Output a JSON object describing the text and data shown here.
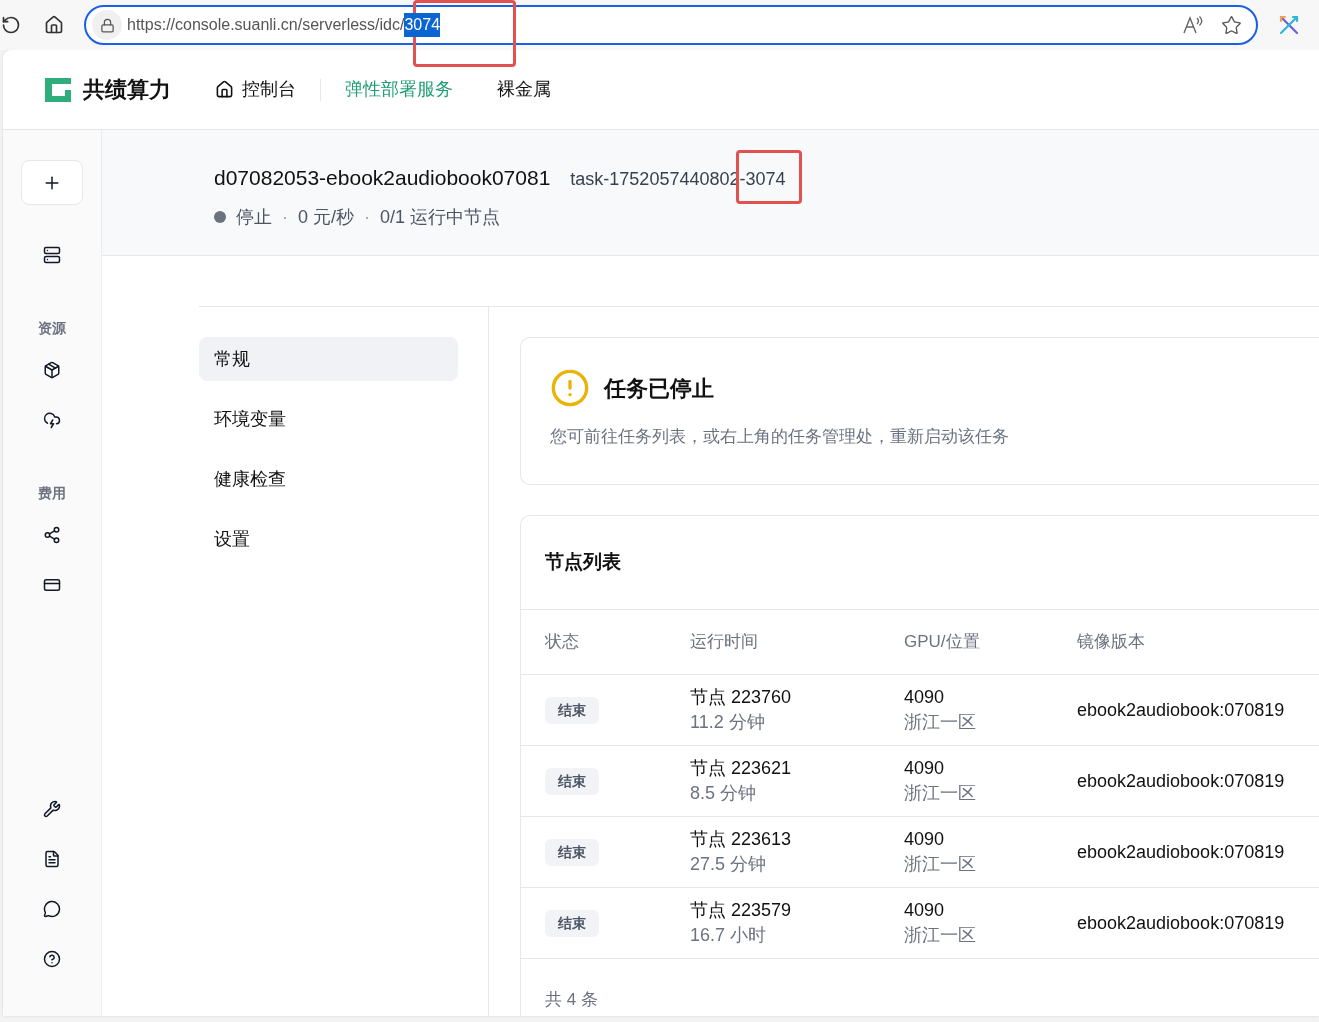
{
  "browser": {
    "url": "https://console.suanli.cn/serverless/idc/",
    "url_selected": "3074"
  },
  "header": {
    "brand": "共绩算力",
    "nav": [
      {
        "label": "控制台",
        "kind": "home",
        "selected": false
      },
      {
        "label": "弹性部署服务",
        "kind": "plain",
        "selected": true
      },
      {
        "label": "裸金属",
        "kind": "plain",
        "selected": false
      }
    ]
  },
  "sidebar": {
    "headings": [
      "资源",
      "费用"
    ]
  },
  "task": {
    "name": "d07082053-ebook2audiobook07081",
    "id": "task-1752057440802-3074",
    "status": "停止",
    "separator": "·",
    "price": "0 元/秒",
    "nodes": "0/1 运行中节点"
  },
  "tabs": [
    {
      "label": "常规",
      "selected": true
    },
    {
      "label": "环境变量",
      "selected": false
    },
    {
      "label": "健康检查",
      "selected": false
    },
    {
      "label": "设置",
      "selected": false
    }
  ],
  "notice": {
    "title": "任务已停止",
    "text": "您可前往任务列表，或右上角的任务管理处，重新启动该任务"
  },
  "node_list": {
    "title": "节点列表",
    "columns": [
      "状态",
      "运行时间",
      "GPU/位置",
      "镜像版本"
    ],
    "rows": [
      {
        "status": "结束",
        "node": "节点 223760",
        "time": "11.2 分钟",
        "gpu": "4090",
        "region": "浙江一区",
        "image": "ebook2audiobook:070819"
      },
      {
        "status": "结束",
        "node": "节点 223621",
        "time": "8.5 分钟",
        "gpu": "4090",
        "region": "浙江一区",
        "image": "ebook2audiobook:070819"
      },
      {
        "status": "结束",
        "node": "节点 223613",
        "time": "27.5 分钟",
        "gpu": "4090",
        "region": "浙江一区",
        "image": "ebook2audiobook:070819"
      },
      {
        "status": "结束",
        "node": "节点 223579",
        "time": "16.7 小时",
        "gpu": "4090",
        "region": "浙江一区",
        "image": "ebook2audiobook:070819"
      }
    ],
    "total": "共 4 条"
  }
}
